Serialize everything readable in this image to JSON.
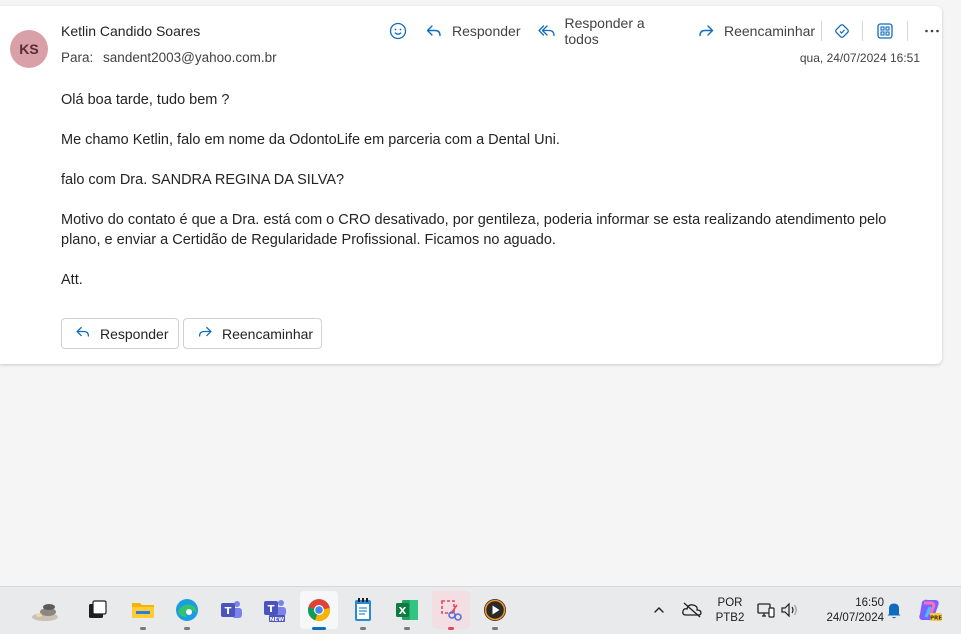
{
  "email": {
    "avatar_initials": "KS",
    "sender": "Ketlin Candido Soares",
    "to_label": "Para:",
    "to_address": "sandent2003@yahoo.com.br",
    "date": "qua, 24/07/2024 16:51",
    "actions": {
      "reply": "Responder",
      "reply_all": "Responder a todos",
      "forward": "Reencaminhar"
    },
    "body": [
      "Olá boa tarde, tudo bem ?",
      "Me chamo Ketlin, falo em nome da OdontoLife em parceria com a Dental Uni.",
      "falo com Dra. SANDRA REGINA DA SILVA?",
      "Motivo do contato é que a Dra. está com o CRO desativado, por gentileza, poderia informar se esta realizando atendimento pelo plano, e enviar a Certidão de Regularidade Profissional. Ficamos no aguado.",
      "Att."
    ],
    "footer_buttons": {
      "reply": "Responder",
      "forward": "Reencaminhar"
    }
  },
  "taskbar": {
    "language": "POR",
    "keyboard": "PTB2",
    "time": "16:50",
    "date": "24/07/2024",
    "apps": [
      "widgets-icon",
      "task-view-icon",
      "file-explorer-icon",
      "edge-icon",
      "teams-icon",
      "teams-new-icon",
      "chrome-icon",
      "notepad-icon",
      "excel-icon",
      "snipping-tool-icon",
      "media-player-icon"
    ],
    "colors": {
      "accent": "#0f6cbd",
      "avatar": "#d9a0a8"
    }
  }
}
